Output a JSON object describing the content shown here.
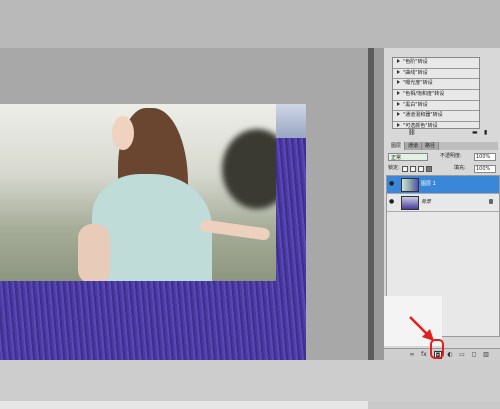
{
  "actions_panel": {
    "items": [
      "\"色阶\"转设",
      "\"曲线\"转设",
      "\"曝光度\"转设",
      "\"色相/饱和度\"转设",
      "\"黑白\"转设",
      "\"通道混和器\"转设",
      "\"可选颜色\"转设"
    ]
  },
  "layers_panel": {
    "tabs": [
      "图层",
      "通道",
      "路径"
    ],
    "blend_mode": "正常",
    "opacity_label": "不透明度:",
    "opacity_value": "100%",
    "lock_label": "锁定:",
    "fill_label": "填充:",
    "fill_value": "100%",
    "layers": [
      {
        "name": "图层 1",
        "selected": true
      },
      {
        "name": "背景",
        "selected": false,
        "locked": true
      }
    ]
  },
  "bottom_bar": {
    "buttons": [
      "link-icon",
      "fx-icon",
      "add-layer-mask-icon",
      "adjustment-icon",
      "group-icon",
      "new-layer-icon",
      "delete-icon"
    ],
    "fx_label": "fx"
  },
  "annotation": {
    "color": "#e0201c"
  }
}
